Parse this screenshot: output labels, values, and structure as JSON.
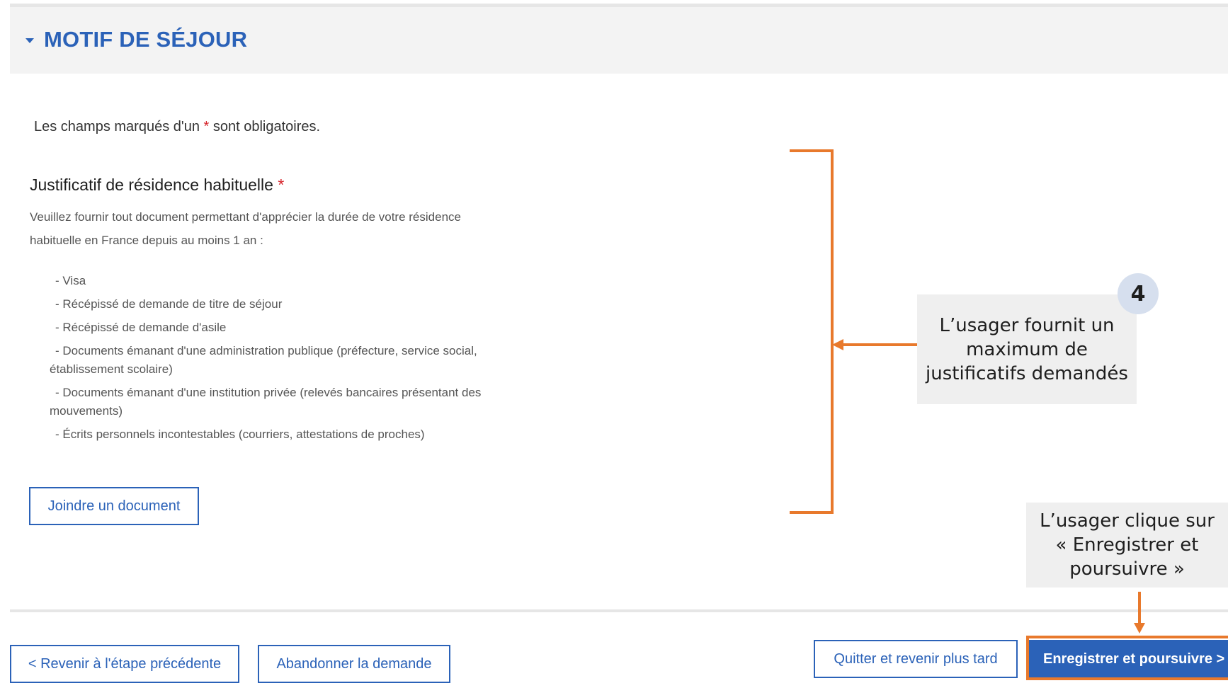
{
  "section": {
    "title": "MOTIF DE SÉJOUR"
  },
  "form": {
    "required_note_before": "Les champs marqués d'un ",
    "required_star": "*",
    "required_note_after": " sont obligatoires.",
    "field_label": "Justificatif de résidence habituelle",
    "field_star": "*",
    "help_text": "Veuillez fournir tout document permettant d'apprécier la durée de votre résidence habituelle en France depuis au moins 1 an :",
    "documents": [
      "- Visa",
      "- Récépissé de demande de titre de séjour",
      "- Récépissé de demande d'asile",
      "- Documents émanant d'une administration publique (préfecture, service social, établissement scolaire)",
      "- Documents émanant d'une institution privée (relevés bancaires présentant des mouvements)",
      "- Écrits personnels incontestables (courriers, attestations de proches)"
    ],
    "attach_label": "Joindre un document"
  },
  "footer": {
    "prev_label": "< Revenir à l'étape précédente",
    "abandon_label": "Abandonner la demande",
    "quit_label": "Quitter et revenir plus tard",
    "save_label": "Enregistrer et poursuivre >"
  },
  "annotations": {
    "step_number": "4",
    "callout_documents": "L’usager fournit un maximum de justificatifs demandés",
    "callout_save": "L’usager clique sur « Enregistrer et poursuivre »",
    "accent_color": "#e8792c"
  },
  "colors": {
    "primary": "#2b62b8",
    "required": "#d6232a",
    "header_bg": "#f3f3f3"
  }
}
